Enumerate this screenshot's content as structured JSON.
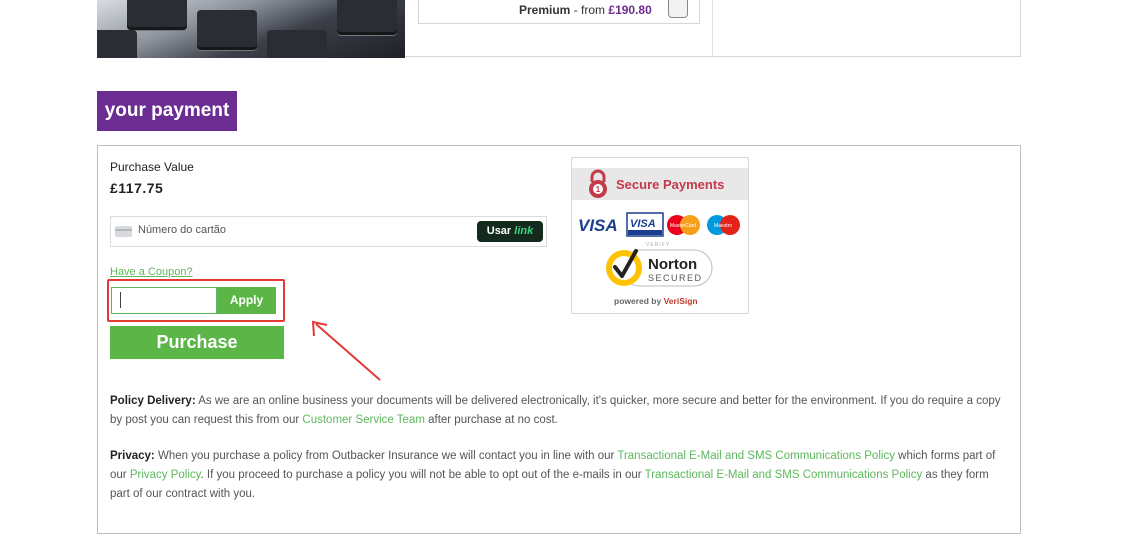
{
  "plan_option": {
    "name": "Premium",
    "from_text": "- from",
    "price": "£190.80"
  },
  "section": {
    "heading": "your payment"
  },
  "payment": {
    "purchase_value_label": "Purchase Value",
    "purchase_value": "£117.75",
    "card_number_placeholder": "Número do cartão",
    "link_button": {
      "prefix": "Usar",
      "suffix": "link"
    },
    "coupon_link": "Have a Coupon?",
    "coupon_input_value": "",
    "apply_label": "Apply",
    "purchase_label": "Purchase"
  },
  "secure_badge": {
    "title": "Secure Payments",
    "card_logos": [
      "VISA",
      "VISA Electron",
      "MasterCard",
      "Maestro"
    ],
    "verify_text": "VERIFY",
    "norton_name": "Norton",
    "norton_secured": "SECURED",
    "powered_by": "powered by",
    "verisign": "VeriSign"
  },
  "policy_delivery": {
    "label": "Policy Delivery:",
    "text_1": " As we are an online business your documents will be delivered electronically, it's quicker, more secure and better for the environment. If you do require a copy by post you can request this from our ",
    "link_1": "Customer Service Team",
    "text_2": " after purchase at no cost."
  },
  "privacy": {
    "label": "Privacy:",
    "text_1": " When you purchase a policy from Outbacker Insurance we will contact you in line with our ",
    "link_1": "Transactional E-Mail and SMS Communications Policy",
    "text_2": " which forms part of our ",
    "link_2": "Privacy Policy",
    "text_3": ". If you proceed to purchase a policy you will not be able to opt out of the e-mails in our ",
    "link_3": "Transactional E-Mail and SMS Communications Policy",
    "text_4": " as they form part of our contract with you."
  },
  "colors": {
    "brand_purple": "#6b2d91",
    "action_green": "#5cb547",
    "link_green": "#5cb85c",
    "highlight_red": "#e53935"
  }
}
